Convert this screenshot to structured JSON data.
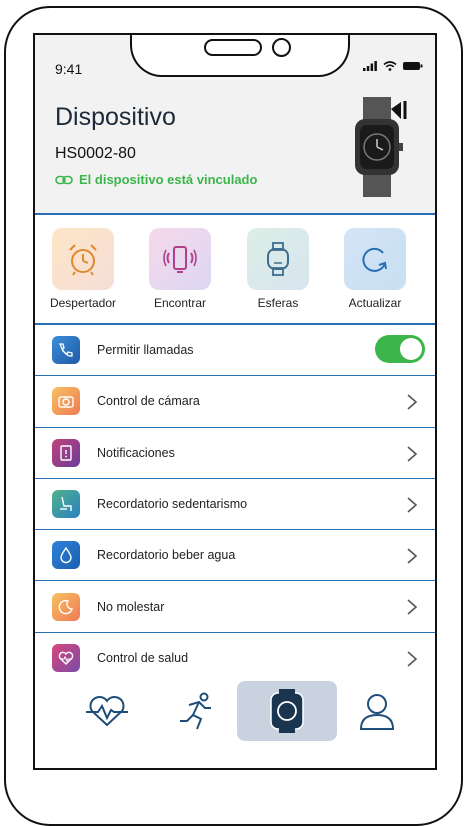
{
  "status": {
    "time": "9:41"
  },
  "header": {
    "title": "Dispositivo",
    "model": "HS0002-80",
    "linked_text": "El dispositivo está vinculado"
  },
  "quick_actions": [
    {
      "label": "Despertador"
    },
    {
      "label": "Encontrar"
    },
    {
      "label": "Esferas"
    },
    {
      "label": "Actualizar"
    }
  ],
  "settings": [
    {
      "label": "Permitir llamadas",
      "toggle": true
    },
    {
      "label": "Control de cámara"
    },
    {
      "label": "Notificaciones"
    },
    {
      "label": "Recordatorio sedentarismo"
    },
    {
      "label": "Recordatorio beber agua"
    },
    {
      "label": "No molestar"
    },
    {
      "label": "Control de salud"
    }
  ],
  "nav": [
    "heart-rate-icon",
    "running-icon",
    "watch-icon",
    "profile-icon"
  ],
  "colors": {
    "accent": "#2a6fb5",
    "success": "#3cb54a",
    "nav_active": "#c9d3e0"
  }
}
